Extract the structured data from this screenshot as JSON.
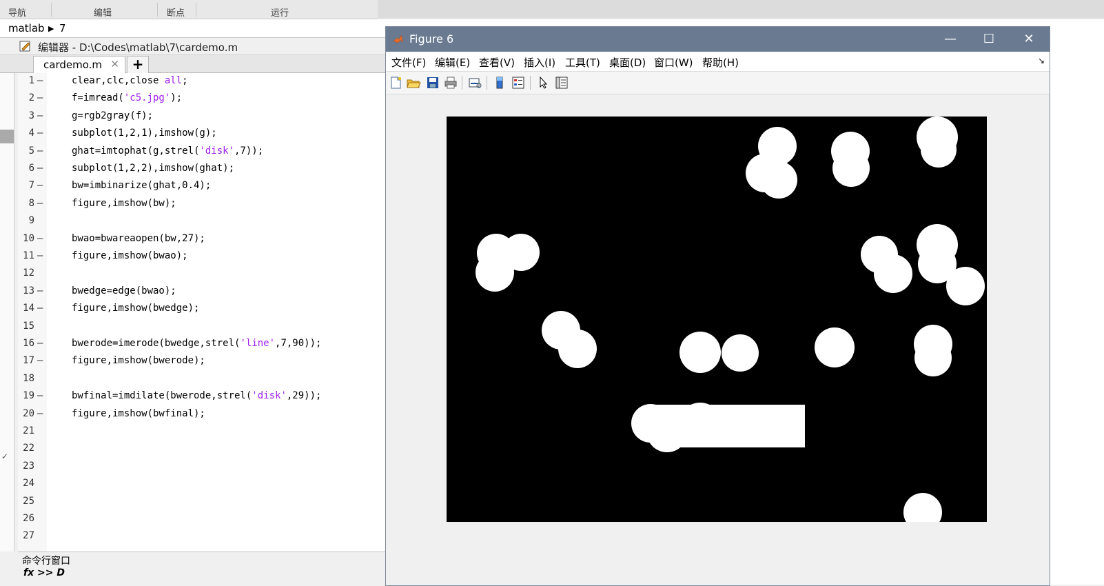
{
  "toolstrip": {
    "sections": [
      "导航",
      "编辑",
      "断点",
      "运行"
    ]
  },
  "address": {
    "root": "matlab",
    "folder": "7"
  },
  "editor": {
    "title": "编辑器 - D:\\Codes\\matlab\\7\\cardemo.m",
    "tab_label": "cardemo.m",
    "lines": [
      {
        "n": "1",
        "dash": "—",
        "parts": [
          {
            "t": "clear,clc,close "
          },
          {
            "t": "all",
            "s": true
          },
          {
            "t": ";"
          }
        ]
      },
      {
        "n": "2",
        "dash": "—",
        "parts": [
          {
            "t": "f=imread("
          },
          {
            "t": "'c5.jpg'",
            "s": true
          },
          {
            "t": ");"
          }
        ]
      },
      {
        "n": "3",
        "dash": "—",
        "parts": [
          {
            "t": "g=rgb2gray(f);"
          }
        ]
      },
      {
        "n": "4",
        "dash": "—",
        "parts": [
          {
            "t": "subplot(1,2,1),imshow(g);"
          }
        ]
      },
      {
        "n": "5",
        "dash": "—",
        "parts": [
          {
            "t": "ghat=imtophat(g,strel("
          },
          {
            "t": "'disk'",
            "s": true
          },
          {
            "t": ",7));"
          }
        ]
      },
      {
        "n": "6",
        "dash": "—",
        "parts": [
          {
            "t": "subplot(1,2,2),imshow(ghat);"
          }
        ]
      },
      {
        "n": "7",
        "dash": "—",
        "parts": [
          {
            "t": "bw=imbinarize(ghat,0.4);"
          }
        ]
      },
      {
        "n": "8",
        "dash": "—",
        "parts": [
          {
            "t": "figure,imshow(bw);"
          }
        ]
      },
      {
        "n": "9",
        "dash": "",
        "parts": []
      },
      {
        "n": "10",
        "dash": "—",
        "parts": [
          {
            "t": "bwao=bwareaopen(bw,27);"
          }
        ]
      },
      {
        "n": "11",
        "dash": "—",
        "parts": [
          {
            "t": "figure,imshow(bwao);"
          }
        ]
      },
      {
        "n": "12",
        "dash": "",
        "parts": []
      },
      {
        "n": "13",
        "dash": "—",
        "parts": [
          {
            "t": "bwedge=edge(bwao);"
          }
        ]
      },
      {
        "n": "14",
        "dash": "—",
        "parts": [
          {
            "t": "figure,imshow(bwedge);"
          }
        ]
      },
      {
        "n": "15",
        "dash": "",
        "parts": []
      },
      {
        "n": "16",
        "dash": "—",
        "parts": [
          {
            "t": "bwerode=imerode(bwedge,strel("
          },
          {
            "t": "'line'",
            "s": true
          },
          {
            "t": ",7,90));"
          }
        ]
      },
      {
        "n": "17",
        "dash": "—",
        "parts": [
          {
            "t": "figure,imshow(bwerode);"
          }
        ]
      },
      {
        "n": "18",
        "dash": "",
        "parts": []
      },
      {
        "n": "19",
        "dash": "—",
        "parts": [
          {
            "t": "bwfinal=imdilate(bwerode,strel("
          },
          {
            "t": "'disk'",
            "s": true
          },
          {
            "t": ",29));"
          }
        ]
      },
      {
        "n": "20",
        "dash": "—",
        "parts": [
          {
            "t": "figure,imshow(bwfinal);"
          }
        ]
      },
      {
        "n": "21",
        "dash": "",
        "parts": []
      },
      {
        "n": "22",
        "dash": "",
        "parts": []
      },
      {
        "n": "23",
        "dash": "",
        "parts": []
      },
      {
        "n": "24",
        "dash": "",
        "parts": []
      },
      {
        "n": "25",
        "dash": "",
        "parts": []
      },
      {
        "n": "26",
        "dash": "",
        "parts": []
      },
      {
        "n": "27",
        "dash": "",
        "parts": []
      }
    ],
    "string_color": "#a020f0"
  },
  "command_window": {
    "title": "命令行窗口",
    "prompt": "fx >> D"
  },
  "figure": {
    "title": "Figure 6",
    "titlebar_color": "#6a7b91",
    "menus": [
      "文件(F)",
      "编辑(E)",
      "查看(V)",
      "插入(I)",
      "工具(T)",
      "桌面(D)",
      "窗口(W)",
      "帮助(H)"
    ],
    "toolbar_icons": [
      "new-figure-icon",
      "open-file-icon",
      "save-icon",
      "print-icon",
      "link-plot-icon",
      "colorbar-icon",
      "legend-icon",
      "pointer-icon",
      "property-editor-icon"
    ]
  }
}
